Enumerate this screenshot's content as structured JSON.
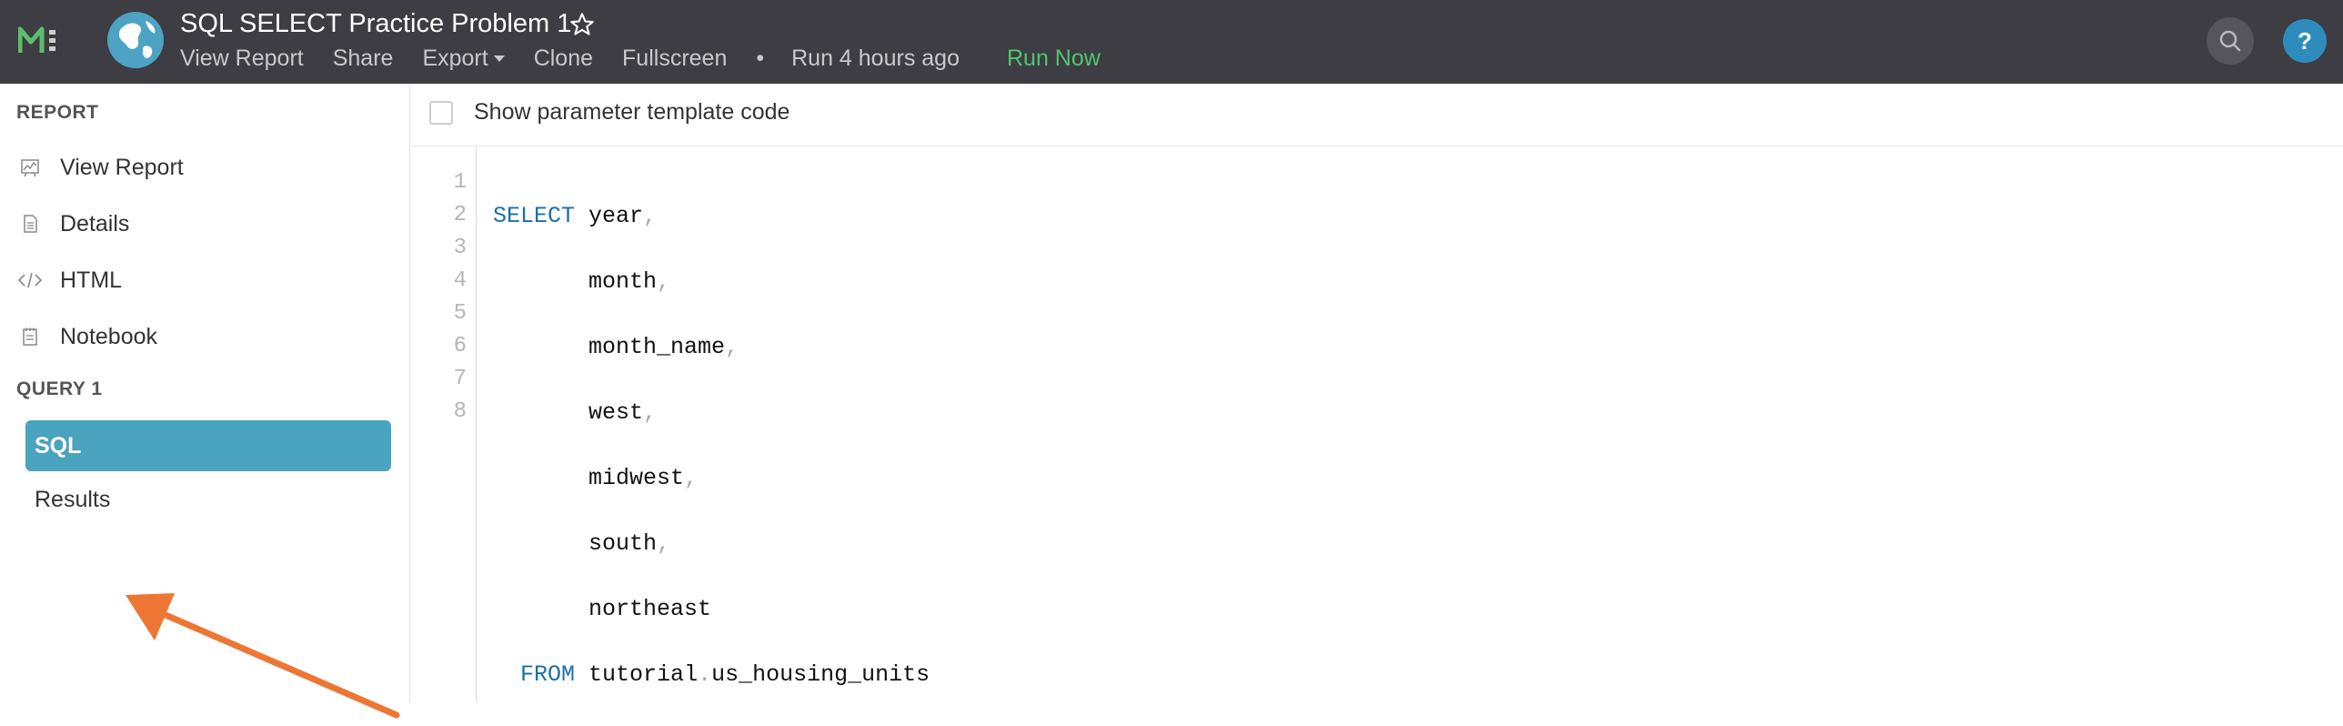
{
  "header": {
    "title": "SQL SELECT Practice Problem 1",
    "menu": {
      "view_report": "View Report",
      "share": "Share",
      "export": "Export",
      "clone": "Clone",
      "fullscreen": "Fullscreen",
      "separator": "•",
      "run_status": "Run 4 hours ago",
      "run_now": "Run Now"
    },
    "help_label": "?",
    "icons": [
      "mode-logo-icon",
      "globe-avatar-icon",
      "star-icon",
      "search-icon",
      "help-icon"
    ]
  },
  "sidebar": {
    "report_section": "REPORT",
    "report_items": [
      {
        "label": "View Report",
        "icon": "chart-icon"
      },
      {
        "label": "Details",
        "icon": "document-icon"
      },
      {
        "label": "HTML",
        "icon": "code-icon"
      },
      {
        "label": "Notebook",
        "icon": "notebook-icon"
      }
    ],
    "query_section": "QUERY 1",
    "query_items": [
      {
        "label": "SQL",
        "active": true
      },
      {
        "label": "Results",
        "active": false
      }
    ]
  },
  "editor": {
    "param_label": "Show parameter template code",
    "param_checked": false,
    "line_numbers": [
      "1",
      "2",
      "3",
      "4",
      "5",
      "6",
      "7",
      "8"
    ],
    "code": {
      "l1_kw": "SELECT",
      "l1_id": "year",
      "l1_p": ",",
      "l2_id": "month",
      "l2_p": ",",
      "l3_id": "month_name",
      "l3_p": ",",
      "l4_id": "west",
      "l4_p": ",",
      "l5_id": "midwest",
      "l5_p": ",",
      "l6_id": "south",
      "l6_p": ",",
      "l7_id": "northeast",
      "l8_kw": "FROM",
      "l8_schema": "tutorial",
      "l8_dot": ".",
      "l8_table": "us_housing_units"
    }
  },
  "colors": {
    "topbar": "#3d3d43",
    "accent": "#4aa3bf",
    "run_now": "#50c66b",
    "keyword": "#1d6fa5",
    "annotation_arrow": "#ee7634"
  }
}
